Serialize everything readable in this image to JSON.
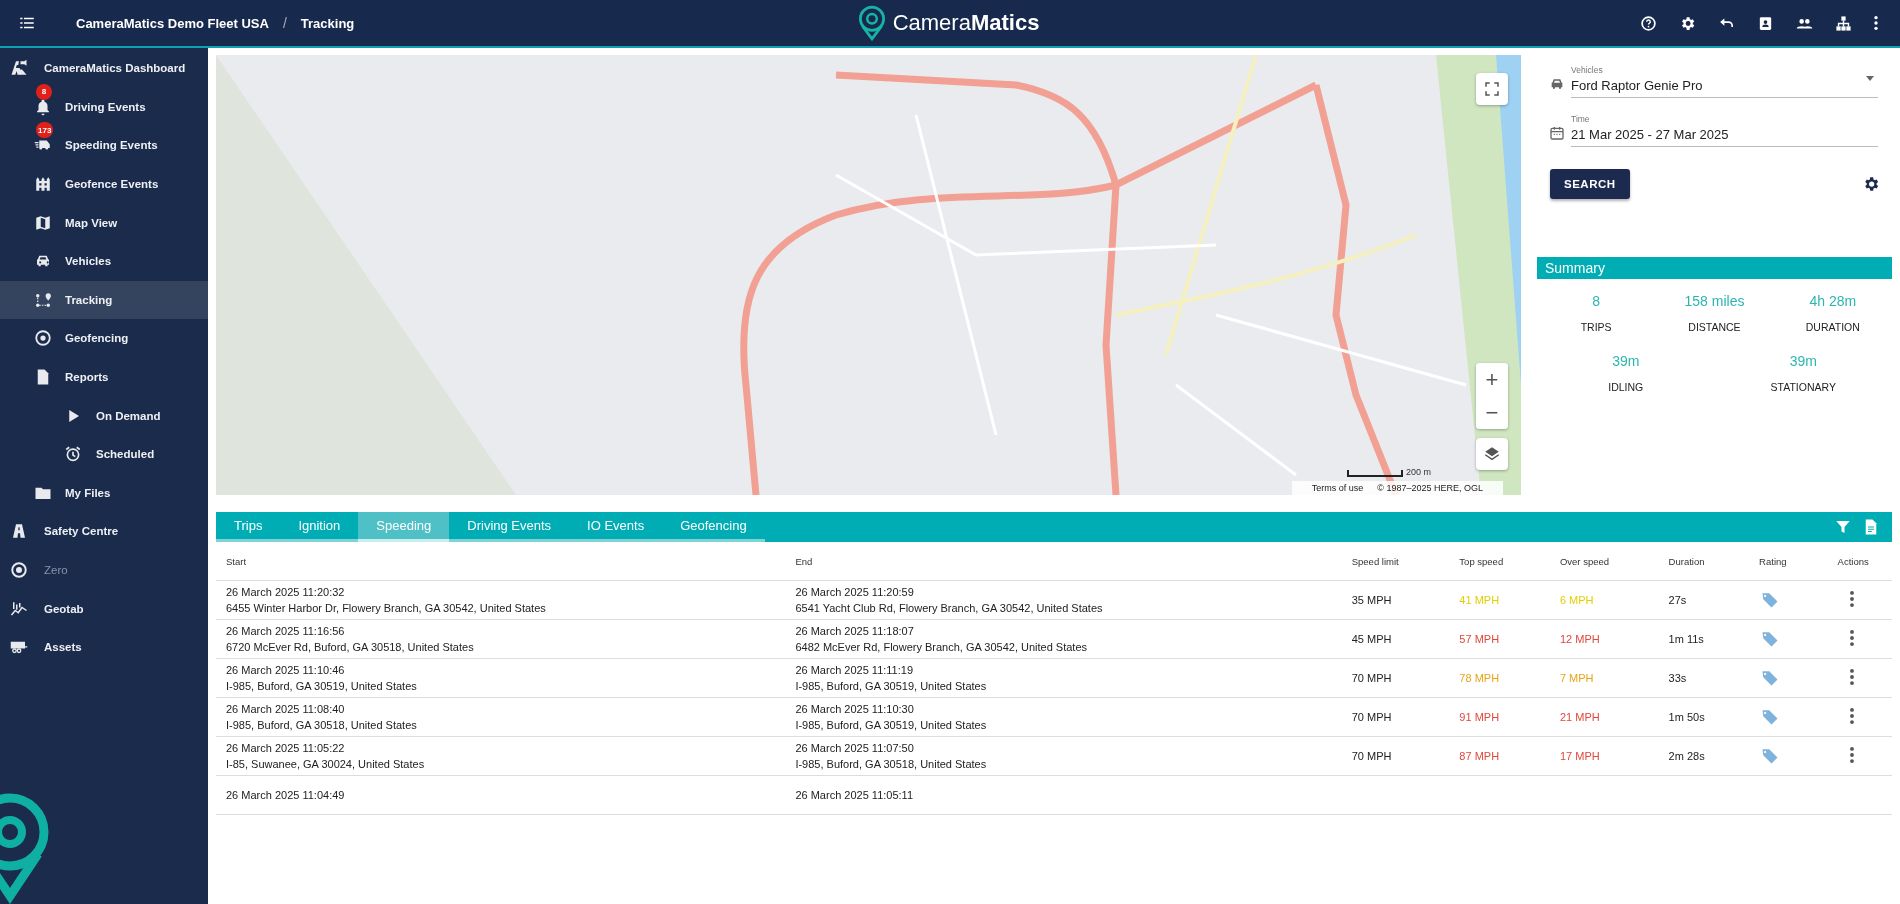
{
  "topbar": {
    "breadcrumb": [
      "CameraMatics Demo Fleet USA",
      "Tracking"
    ],
    "separator": "/",
    "logo": "Camera**Matics**"
  },
  "sidebar": {
    "items": [
      {
        "label": "CameraMatics Dashboard",
        "selected": false,
        "disabled": false,
        "children": [
          {
            "label": "Driving Events",
            "badge": "8",
            "selected": false
          },
          {
            "label": "Speeding Events",
            "badge": "173",
            "selected": false
          },
          {
            "label": "Geofence Events",
            "selected": false
          },
          {
            "label": "Map View",
            "selected": false
          },
          {
            "label": "Vehicles",
            "selected": false
          },
          {
            "label": "Tracking",
            "selected": true
          },
          {
            "label": "Geofencing",
            "selected": false
          },
          {
            "label": "Reports",
            "selected": false,
            "children": [
              {
                "label": "On Demand",
                "selected": false
              },
              {
                "label": "Scheduled",
                "selected": false
              }
            ]
          },
          {
            "label": "My Files",
            "selected": false
          }
        ]
      },
      {
        "label": "Safety Centre",
        "selected": false,
        "disabled": false
      },
      {
        "label": "Zero",
        "selected": false,
        "disabled": true
      },
      {
        "label": "Geotab",
        "selected": false,
        "disabled": false
      },
      {
        "label": "Assets",
        "selected": false,
        "disabled": false
      }
    ]
  },
  "map": {
    "scale": "200 m",
    "terms": "Terms of use",
    "copyright": "© 1987–2025 HERE, OGL",
    "zoom_in": "+",
    "zoom_out": "−"
  },
  "filters": {
    "vehicle": {
      "label": "Vehicles",
      "value": "Ford Raptor Genie Pro"
    },
    "time": {
      "label": "Time",
      "value": "21 Mar 2025 - 27 Mar 2025"
    },
    "search_button": "SEARCH"
  },
  "summary": {
    "title": "Summary",
    "stats": [
      {
        "value": "8",
        "label": "TRIPS"
      },
      {
        "value": "158 miles",
        "label": "DISTANCE"
      },
      {
        "value": "4h 28m",
        "label": "DURATION"
      },
      {
        "value": "39m",
        "label": "IDLING"
      },
      {
        "value": "39m",
        "label": "STATIONARY"
      }
    ]
  },
  "tabs": [
    {
      "label": "Trips",
      "selected": false
    },
    {
      "label": "Ignition",
      "selected": false
    },
    {
      "label": "Speeding",
      "selected": true
    },
    {
      "label": "Driving Events",
      "selected": false
    },
    {
      "label": "IO Events",
      "selected": false
    },
    {
      "label": "Geofencing",
      "selected": false
    }
  ],
  "table": {
    "columns": [
      "Start",
      "End",
      "Speed limit",
      "Top speed",
      "Over speed",
      "Duration",
      "Rating",
      "Actions"
    ],
    "rows": [
      {
        "start_time": "26 March 2025 11:20:32",
        "start_address": "6455 Winter Harbor Dr, Flowery Branch, GA 30542, United States",
        "end_time": "26 March 2025 11:20:59",
        "end_address": "6541 Yacht Club Rd, Flowery Branch, GA 30542, United States",
        "speed_limit": "35 MPH",
        "top_speed": "41 MPH",
        "over_speed": "6 MPH",
        "duration": "27s",
        "color": "#e3cf00"
      },
      {
        "start_time": "26 March 2025 11:16:56",
        "start_address": "6720 McEver Rd, Buford, GA 30518, United States",
        "end_time": "26 March 2025 11:18:07",
        "end_address": "6482 McEver Rd, Flowery Branch, GA 30542, United States",
        "speed_limit": "45 MPH",
        "top_speed": "57 MPH",
        "over_speed": "12 MPH",
        "duration": "1m 11s",
        "color": "#e0473c"
      },
      {
        "start_time": "26 March 2025 11:10:46",
        "start_address": "I-985, Buford, GA 30519, United States",
        "end_time": "26 March 2025 11:11:19",
        "end_address": "I-985, Buford, GA 30519, United States",
        "speed_limit": "70 MPH",
        "top_speed": "78 MPH",
        "over_speed": "7 MPH",
        "duration": "33s",
        "color": "#e8a317"
      },
      {
        "start_time": "26 March 2025 11:08:40",
        "start_address": "I-985, Buford, GA 30518, United States",
        "end_time": "26 March 2025 11:10:30",
        "end_address": "I-985, Buford, GA 30519, United States",
        "speed_limit": "70 MPH",
        "top_speed": "91 MPH",
        "over_speed": "21 MPH",
        "duration": "1m 50s",
        "color": "#e0473c"
      },
      {
        "start_time": "26 March 2025 11:05:22",
        "start_address": "I-85, Suwanee, GA 30024, United States",
        "end_time": "26 March 2025 11:07:50",
        "end_address": "I-985, Buford, GA 30518, United States",
        "speed_limit": "70 MPH",
        "top_speed": "87 MPH",
        "over_speed": "17 MPH",
        "duration": "2m 28s",
        "color": "#e0473c"
      },
      {
        "start_time": "26 March 2025 11:04:49",
        "end_time": "26 March 2025 11:05:11"
      }
    ]
  }
}
